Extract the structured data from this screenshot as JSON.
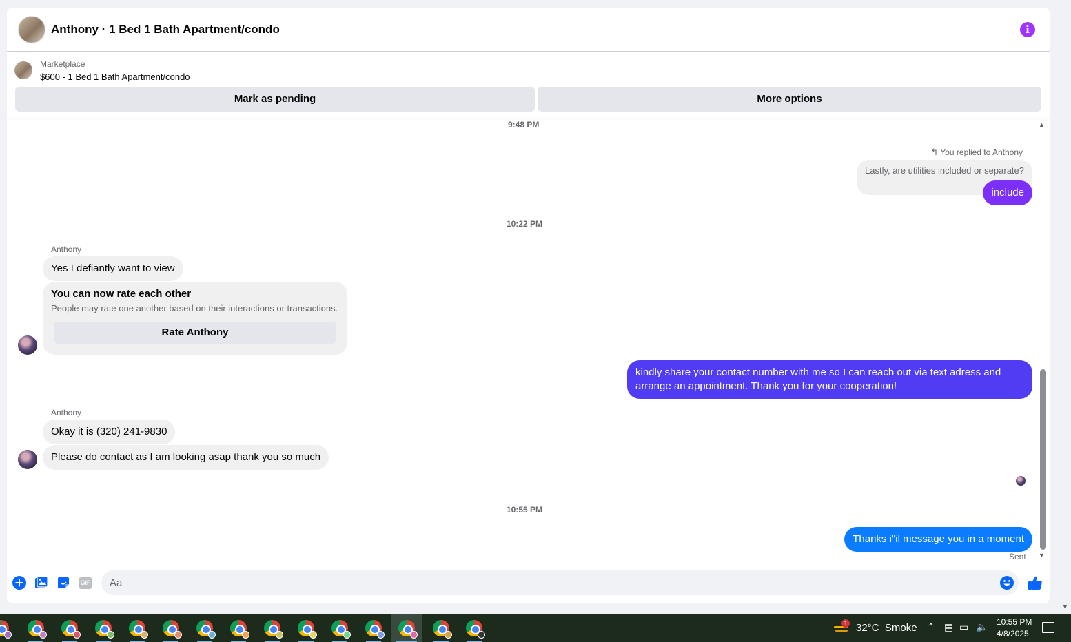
{
  "header": {
    "title": "Anthony · 1 Bed 1 Bath Apartment/condo"
  },
  "marketplace": {
    "label": "Marketplace",
    "item": "$600 - 1 Bed 1 Bath Apartment/condo",
    "pending_label": "Mark as pending",
    "more_label": "More options"
  },
  "messages": {
    "ts1": "9:48 PM",
    "reply_note": "You replied to Anthony",
    "reply_quote": "Lastly, are utilities included or separate?",
    "reply_text": "include",
    "ts2": "10:22 PM",
    "sender1": "Anthony",
    "msg1": "Yes I defiantly want to view",
    "rate_title": "You can now rate each other",
    "rate_sub": "People may rate one another based on their interactions or transactions.",
    "rate_button": "Rate Anthony",
    "out_long_line1": "kindly share your contact number with me so I can reach out via text adress and",
    "out_long_line2": "arrange an appointment. Thank you for your cooperation!",
    "sender2": "Anthony",
    "msg2": "Okay it is (320) 241-9830",
    "msg3": "Please do contact as I am looking asap thank you so much",
    "ts3": "10:55 PM",
    "out_last": "Thanks i\"il message you in a moment",
    "status": "Sent"
  },
  "composer": {
    "placeholder": "Aa"
  },
  "icons": {
    "info": "info-icon",
    "add": "plus-circle-icon",
    "photo": "image-icon",
    "sticker": "sticker-icon",
    "gif": "GIF",
    "emoji": "emoji-icon",
    "like": "thumbs-up-icon"
  },
  "taskbar": {
    "weather": "32°C  Smoke",
    "weather_badge": "1",
    "time": "10:55 PM",
    "date": "4/8/2025"
  },
  "colors": {
    "accent": "#0866ff",
    "purple_bubble": "#7b2ff7",
    "indigo_bubble": "#4f3cf3",
    "blue_bubble": "#0a7cff",
    "info_icon": "#a033ff"
  }
}
